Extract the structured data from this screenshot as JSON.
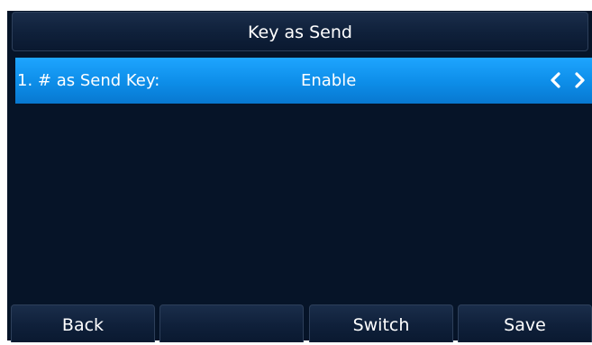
{
  "title": "Key as Send",
  "rows": [
    {
      "label": "1. # as Send Key:",
      "value": "Enable",
      "left_icon": "chevron-left-icon",
      "right_icon": "chevron-right-icon"
    }
  ],
  "softkeys": [
    "Back",
    "",
    "Switch",
    "Save"
  ],
  "colors": {
    "background": "#061428",
    "selected_row": "#1ea5ff",
    "bar": "#0f203a",
    "text": "#ffffff"
  }
}
